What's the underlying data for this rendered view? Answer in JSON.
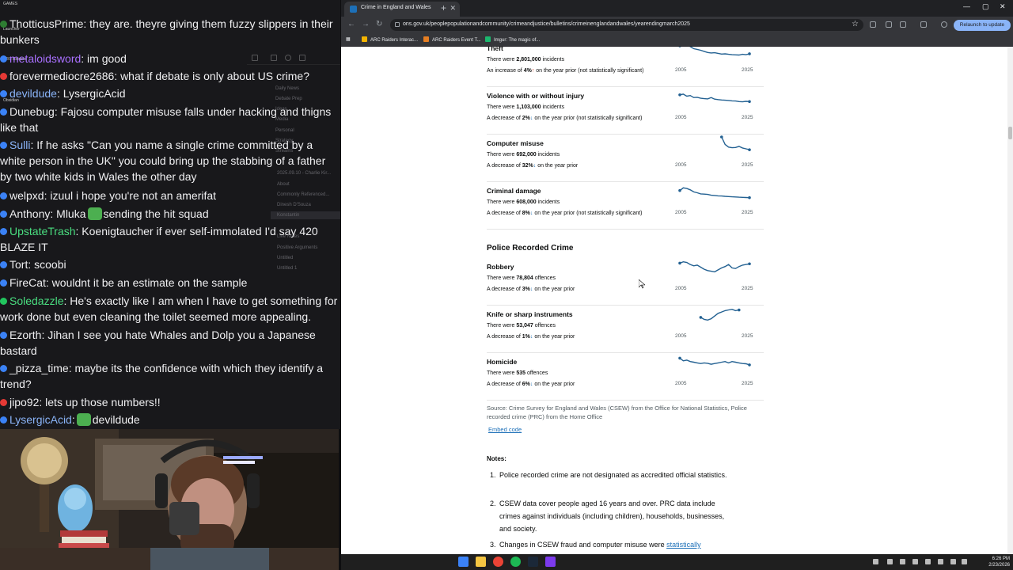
{
  "chat": {
    "messages": [
      {
        "user": "ThotticusPrime",
        "user_color": "#efeff1",
        "text": ": they are. theyre giving them fuzzy slippers in their bunkers",
        "badge": "#2e7d32"
      },
      {
        "user": "metaloidsword",
        "user_color": "#a970ff",
        "text": ": im good",
        "badge": "#3b82f6"
      },
      {
        "user": "forevermediocre2686",
        "user_color": "#efeff1",
        "text": ": what if debate is only about US crime?",
        "badge": "#e53935"
      },
      {
        "user": "devildude",
        "user_color": "#8ab4f8",
        "text": ": LysergicAcid",
        "badge": "#3b82f6"
      },
      {
        "user": "Dunebug",
        "user_color": "#efeff1",
        "text": ": Fajosu computer misuse falls under hacking and thigns like that",
        "badge": "#3b82f6"
      },
      {
        "user": "Sulli",
        "user_color": "#8ab4f8",
        "text": ": If he asks \"Can you name a single crime committed by a white person in the UK\" you could bring up the stabbing of a father by two white kids in Wales the other day",
        "badge": "#3b82f6"
      },
      {
        "user": "welpxd",
        "user_color": "#efeff1",
        "text": ": izuul i hope you're not an amerifat",
        "badge": "#3b82f6"
      },
      {
        "user": "Anthony",
        "user_color": "#efeff1",
        "text": ": Mluka",
        "text2": "sending the hit squad",
        "badge": "#3b82f6"
      },
      {
        "user": "UpstateTrash",
        "user_color": "#4ade80",
        "text": ": Koenigtaucher if ever self-immolated I'd say 420 BLAZE IT",
        "badge": "#3b82f6"
      },
      {
        "user": "Tort",
        "user_color": "#efeff1",
        "text": ": scoobi",
        "badge": "#3b82f6"
      },
      {
        "user": "FireCat",
        "user_color": "#efeff1",
        "text": ": wouldnt it be an estimate on the sample",
        "badge": "#3b82f6"
      },
      {
        "user": "Soledazzle",
        "user_color": "#4ade80",
        "text": ": He's exactly like I am when I have to get something for work done but even cleaning the toilet seemed more appealing.",
        "badge": "#22c55e"
      },
      {
        "user": "Ezorth",
        "user_color": "#efeff1",
        "text": ": Jihan I see you hate Whales and Dolp you a Japanese bastard",
        "badge": "#3b82f6"
      },
      {
        "user": "_pizza_time",
        "user_color": "#efeff1",
        "text": ": maybe its the confidence with which they identify a trend?",
        "badge": "#3b82f6"
      },
      {
        "user": "jipo92",
        "user_color": "#efeff1",
        "text": ": lets up those numbers!!",
        "badge": "#e53935"
      },
      {
        "user": "LysergicAcid",
        "user_color": "#8ab4f8",
        "text": ":",
        "text2": "devildude",
        "badge": "#3b82f6"
      }
    ],
    "launcher": [
      "GAMES",
      "Launcher",
      "ARC Raiders",
      "Obsidian"
    ]
  },
  "obsidian_ghost": {
    "items": [
      "Daily News",
      "Debate Prep",
      "Ideas",
      "Media",
      "Personal",
      "Strategy",
      "Streams",
      "2025.09.10 - Charlie Kir...",
      "About",
      "Commonly Referenced...",
      "Dinesh D'Souza",
      "Konstantin",
      "Live Notes",
      "Positive Arguments",
      "Untitled",
      "Untitled 1"
    ]
  },
  "browser": {
    "tab_title": "Crime in England and Wales",
    "url": "ons.gov.uk/peoplepopulationandcommunity/crimeandjustice/bulletins/crimeinenglandandwales/yearendingmarch2025",
    "relaunch_label": "Relaunch to update",
    "bookmarks": [
      "ARC Raiders Interac...",
      "ARC Raiders Event T...",
      "Imgur: The magic of..."
    ],
    "bookmark_colors": [
      "#f4b400",
      "#e67e22",
      "#1bb76e"
    ]
  },
  "page": {
    "items_top": [
      {
        "name": "Theft",
        "pre": "There were ",
        "value": "2,801,000",
        "unit": " incidents",
        "change_pre": "An increase of ",
        "pct": "4%",
        "dir": "up",
        "change_post": " on the year prior (not statistically significant)",
        "spark": [
          0.3,
          0.1,
          0.2,
          0.35,
          0.5,
          0.55,
          0.62,
          0.7,
          0.78,
          0.82,
          0.8,
          0.85,
          0.9,
          0.88,
          0.92,
          0.95,
          0.96,
          0.97,
          0.92,
          0.95,
          0.88
        ],
        "start": 0
      },
      {
        "name": "Violence with or without injury",
        "pre": "There were ",
        "value": "1,103,000",
        "unit": " incidents",
        "change_pre": "A decrease of ",
        "pct": "2%",
        "dir": "down",
        "change_post": " on the year prior (not statistically significant)",
        "spark": [
          0.4,
          0.35,
          0.5,
          0.45,
          0.6,
          0.58,
          0.65,
          0.68,
          0.7,
          0.6,
          0.72,
          0.75,
          0.78,
          0.8,
          0.82,
          0.85,
          0.86,
          0.9,
          0.92,
          0.88,
          0.9
        ],
        "start": 0
      },
      {
        "name": "Computer misuse",
        "pre": "There were ",
        "value": "692,000",
        "unit": " incidents",
        "change_pre": "A decrease of ",
        "pct": "32%",
        "dir": "down",
        "change_post": " on the year prior",
        "spark": [
          0.0,
          0.55,
          0.75,
          0.8,
          0.78,
          0.7,
          0.82,
          0.88,
          0.95
        ],
        "start": 12
      },
      {
        "name": "Criminal damage",
        "pre": "There were ",
        "value": "608,000",
        "unit": " incidents",
        "change_pre": "A decrease of ",
        "pct": "8%",
        "dir": "down",
        "change_post": " on the year prior (not statistically significant)",
        "spark": [
          0.45,
          0.25,
          0.3,
          0.4,
          0.55,
          0.62,
          0.7,
          0.72,
          0.74,
          0.8,
          0.82,
          0.85,
          0.86,
          0.88,
          0.9,
          0.92,
          0.93,
          0.95,
          0.96,
          0.97,
          0.98
        ],
        "start": 0
      }
    ],
    "prc_title": "Police Recorded Crime",
    "items_prc": [
      {
        "name": "Robbery",
        "pre": "There were ",
        "value": "78,804",
        "unit": " offences",
        "change_pre": "A decrease of ",
        "pct": "3%",
        "dir": "down",
        "change_post": " on the year prior",
        "spark": [
          0.2,
          0.1,
          0.15,
          0.3,
          0.4,
          0.35,
          0.5,
          0.65,
          0.75,
          0.8,
          0.85,
          0.7,
          0.55,
          0.45,
          0.3,
          0.55,
          0.6,
          0.45,
          0.35,
          0.3,
          0.25
        ],
        "start": 0
      },
      {
        "name": "Knife or sharp instruments",
        "pre": "There were ",
        "value": "53,047",
        "unit": " offences",
        "change_pre": "A decrease of ",
        "pct": "1%",
        "dir": "down",
        "change_post": " on the year prior",
        "spark": [
          0.7,
          0.85,
          0.9,
          0.8,
          0.6,
          0.4,
          0.3,
          0.2,
          0.15,
          0.1,
          0.2,
          0.15
        ],
        "start": 6
      },
      {
        "name": "Homicide",
        "pre": "There were ",
        "value": "535",
        "unit": " offences",
        "change_pre": "A decrease of ",
        "pct": "6%",
        "dir": "down",
        "change_post": " on the year prior",
        "spark": [
          0.2,
          0.4,
          0.35,
          0.45,
          0.5,
          0.55,
          0.6,
          0.55,
          0.58,
          0.65,
          0.6,
          0.55,
          0.5,
          0.45,
          0.55,
          0.45,
          0.5,
          0.55,
          0.6,
          0.62,
          0.7
        ],
        "start": 0
      }
    ],
    "year_start": "2005",
    "year_end": "2025",
    "source": "Source: Crime Survey for England and Wales (CSEW) from the Office for National Statistics, Police recorded crime (PRC) from the Home Office",
    "embed": "Embed code",
    "notes_title": "Notes:",
    "notes": [
      {
        "n": "1.",
        "text": "Police recorded crime are not designated as accredited official statistics."
      },
      {
        "n": "2.",
        "text": "CSEW data cover people aged 16 years and over. PRC data include crimes against individuals (including children), households, businesses, and society."
      },
      {
        "n": "3.",
        "text": "Changes in CSEW fraud and computer misuse were ",
        "link": "statistically"
      }
    ]
  },
  "taskbar": {
    "time": "6:26 PM",
    "date": "2/23/2026"
  },
  "colors": {
    "gov_link": "#1d70b8",
    "spark": "#236192",
    "increase": "#d4351c"
  }
}
